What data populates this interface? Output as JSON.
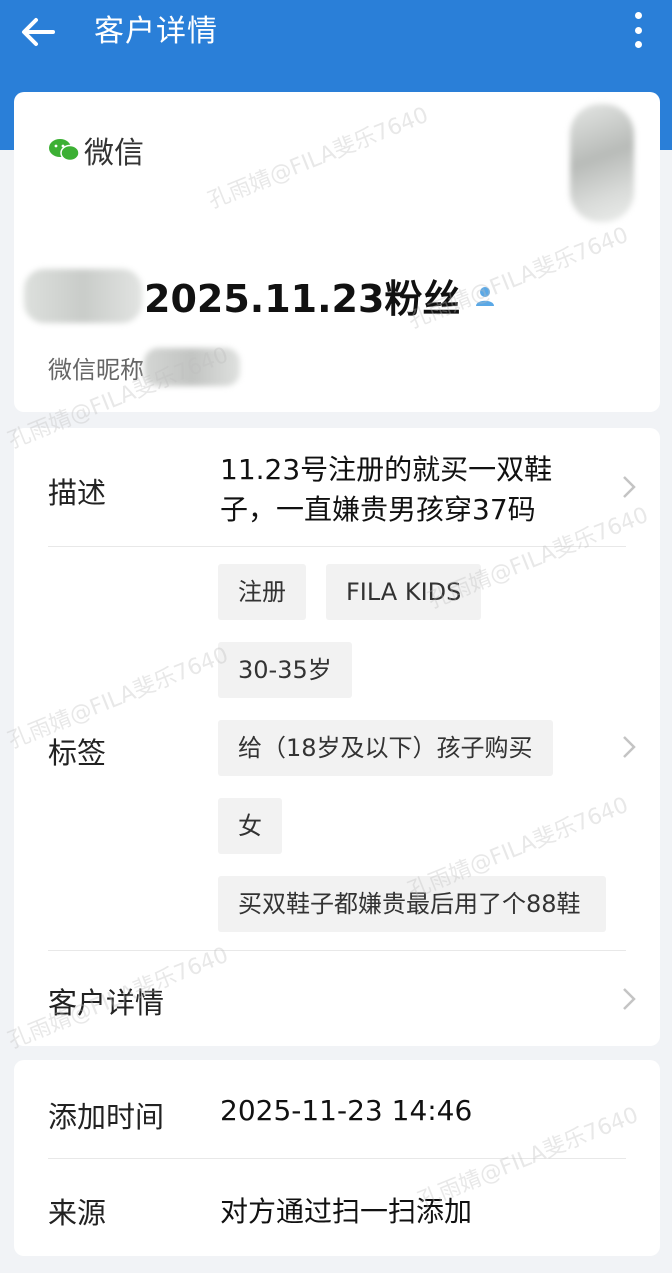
{
  "header": {
    "title": "客户详情",
    "back_icon": "arrow-left-icon",
    "more_icon": "more-vertical-icon",
    "bg_color": "#2a7fd8"
  },
  "profile": {
    "channel_label": "微信",
    "channel_icon": "wechat-icon",
    "name": "2025.11.23粉丝",
    "person_icon": "person-icon",
    "nickname_label": "微信昵称"
  },
  "info": {
    "description_label": "描述",
    "description_text": "11.23号注册的就买一双鞋子，一直嫌贵男孩穿37码",
    "tags_label": "标签",
    "tags": [
      "注册",
      "FILA KIDS",
      "30-35岁",
      "给（18岁及以下）孩子购买",
      "女",
      "买双鞋子都嫌贵最后用了个88鞋"
    ],
    "customer_detail_label": "客户详情"
  },
  "meta": {
    "added_time_label": "添加时间",
    "added_time_value": "2025-11-23 14:46",
    "source_label": "来源",
    "source_value": "对方通过扫一扫添加"
  },
  "watermark_text": "孔雨婧@FILA斐乐7640"
}
